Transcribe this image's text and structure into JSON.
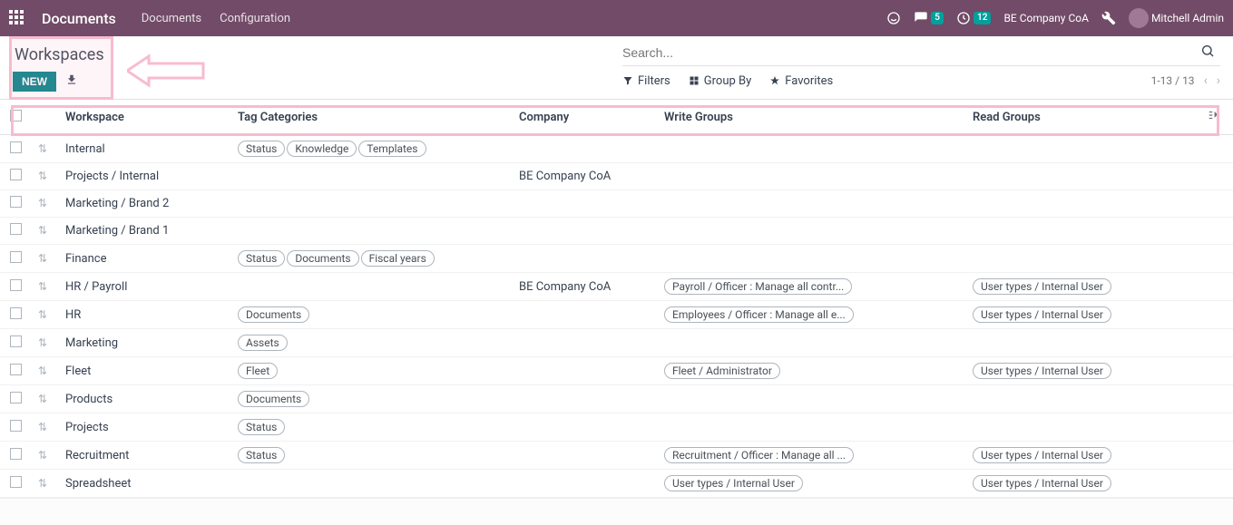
{
  "navbar": {
    "brand": "Documents",
    "menu": [
      "Documents",
      "Configuration"
    ],
    "msg_count": "5",
    "clock_count": "12",
    "company": "BE Company CoA",
    "user": "Mitchell Admin"
  },
  "cp": {
    "title": "Workspaces",
    "new_label": "NEW",
    "search_placeholder": "Search...",
    "filters_label": "Filters",
    "groupby_label": "Group By",
    "favorites_label": "Favorites",
    "pager": "1-13 / 13"
  },
  "columns": {
    "workspace": "Workspace",
    "tag_categories": "Tag Categories",
    "company": "Company",
    "write_groups": "Write Groups",
    "read_groups": "Read Groups"
  },
  "rows": [
    {
      "workspace": "Internal",
      "tags": [
        "Status",
        "Knowledge",
        "Templates"
      ],
      "company": "",
      "write": [],
      "read": []
    },
    {
      "workspace": "Projects / Internal",
      "tags": [],
      "company": "BE Company CoA",
      "write": [],
      "read": []
    },
    {
      "workspace": "Marketing / Brand 2",
      "tags": [],
      "company": "",
      "write": [],
      "read": []
    },
    {
      "workspace": "Marketing / Brand 1",
      "tags": [],
      "company": "",
      "write": [],
      "read": []
    },
    {
      "workspace": "Finance",
      "tags": [
        "Status",
        "Documents",
        "Fiscal years"
      ],
      "company": "",
      "write": [],
      "read": []
    },
    {
      "workspace": "HR / Payroll",
      "tags": [],
      "company": "BE Company CoA",
      "write": [
        "Payroll / Officer : Manage all contr..."
      ],
      "read": [
        "User types / Internal User"
      ]
    },
    {
      "workspace": "HR",
      "tags": [
        "Documents"
      ],
      "company": "",
      "write": [
        "Employees / Officer : Manage all e..."
      ],
      "read": [
        "User types / Internal User"
      ]
    },
    {
      "workspace": "Marketing",
      "tags": [
        "Assets"
      ],
      "company": "",
      "write": [],
      "read": []
    },
    {
      "workspace": "Fleet",
      "tags": [
        "Fleet"
      ],
      "company": "",
      "write": [
        "Fleet / Administrator"
      ],
      "read": [
        "User types / Internal User"
      ]
    },
    {
      "workspace": "Products",
      "tags": [
        "Documents"
      ],
      "company": "",
      "write": [],
      "read": []
    },
    {
      "workspace": "Projects",
      "tags": [
        "Status"
      ],
      "company": "",
      "write": [],
      "read": []
    },
    {
      "workspace": "Recruitment",
      "tags": [
        "Status"
      ],
      "company": "",
      "write": [
        "Recruitment / Officer : Manage all ..."
      ],
      "read": [
        "User types / Internal User"
      ]
    },
    {
      "workspace": "Spreadsheet",
      "tags": [],
      "company": "",
      "write": [
        "User types / Internal User"
      ],
      "read": [
        "User types / Internal User"
      ]
    }
  ]
}
